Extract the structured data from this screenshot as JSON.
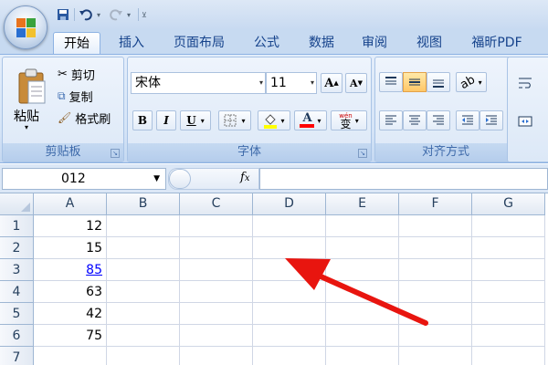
{
  "quick_access": {
    "save_icon": "save-icon",
    "undo_icon": "undo-icon",
    "redo_icon": "redo-icon"
  },
  "tabs": [
    {
      "label": "开始",
      "active": true
    },
    {
      "label": "插入"
    },
    {
      "label": "页面布局"
    },
    {
      "label": "公式"
    },
    {
      "label": "数据"
    },
    {
      "label": "审阅"
    },
    {
      "label": "视图"
    },
    {
      "label": "福昕PDF"
    }
  ],
  "clipboard": {
    "paste_label": "粘贴",
    "cut_label": "剪切",
    "copy_label": "复制",
    "format_painter_label": "格式刷",
    "group_label": "剪贴板"
  },
  "font": {
    "font_name": "宋体",
    "font_size": "11",
    "grow_label": "A",
    "shrink_label": "A",
    "bold_label": "B",
    "italic_label": "I",
    "underline_label": "U",
    "font_color_label": "A",
    "phonetic_label": "变",
    "phonetic_top": "wén",
    "group_label": "字体",
    "fill_color": "#ffff00",
    "font_color": "#ff0000"
  },
  "alignment": {
    "group_label": "对齐方式"
  },
  "formula_bar": {
    "name_box_value": "012",
    "fx_label": "fx"
  },
  "columns": [
    "A",
    "B",
    "C",
    "D",
    "E",
    "F",
    "G"
  ],
  "rows": [
    {
      "num": "1",
      "a": "12"
    },
    {
      "num": "2",
      "a": "15"
    },
    {
      "num": "3",
      "a": "85",
      "link": true
    },
    {
      "num": "4",
      "a": "63"
    },
    {
      "num": "5",
      "a": "42"
    },
    {
      "num": "6",
      "a": "75"
    },
    {
      "num": "7",
      "a": ""
    }
  ],
  "annotation": {
    "arrow_color": "#e8150f"
  }
}
